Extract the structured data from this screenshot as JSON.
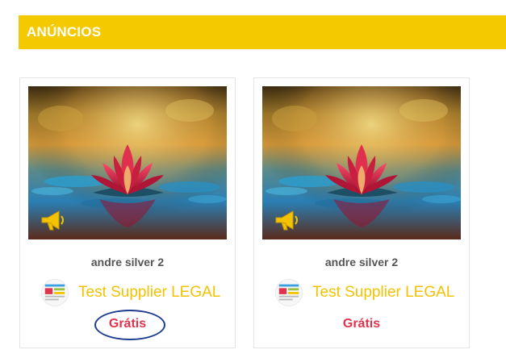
{
  "section": {
    "title": "ANÚNCIOS"
  },
  "colors": {
    "header_bg": "#f5c900",
    "supplier_text": "#f5c200",
    "price_text": "#e0344e",
    "highlight_circle": "#1f3e8f"
  },
  "cards": [
    {
      "image_icon": "lotus-photo",
      "badge_icon": "megaphone-icon",
      "author": "andre silver 2",
      "supplier": "Test Supplier LEGAL",
      "price": "Grátis",
      "price_highlighted": true
    },
    {
      "image_icon": "lotus-photo",
      "badge_icon": "megaphone-icon",
      "author": "andre silver 2",
      "supplier": "Test Supplier LEGAL",
      "price": "Grátis",
      "price_highlighted": false
    }
  ]
}
